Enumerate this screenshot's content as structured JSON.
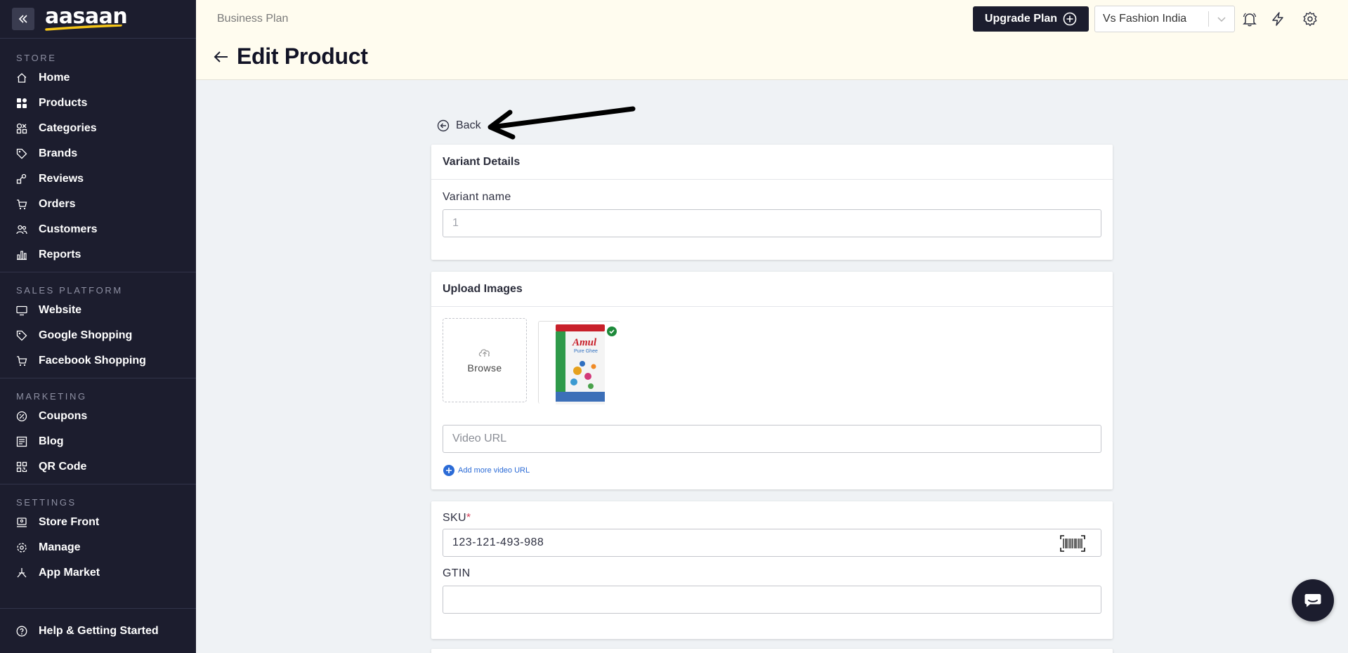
{
  "brand": {
    "logo_text": "aasaan",
    "accent": "#f5c518"
  },
  "sidebar": {
    "sections": [
      {
        "heading": "STORE",
        "items": [
          {
            "label": "Home",
            "icon": "home-icon"
          },
          {
            "label": "Products",
            "icon": "grid-icon"
          },
          {
            "label": "Categories",
            "icon": "categories-icon"
          },
          {
            "label": "Brands",
            "icon": "tag-icon"
          },
          {
            "label": "Reviews",
            "icon": "reviews-icon"
          },
          {
            "label": "Orders",
            "icon": "cart-icon"
          },
          {
            "label": "Customers",
            "icon": "users-icon"
          },
          {
            "label": "Reports",
            "icon": "bar-chart-icon"
          }
        ]
      },
      {
        "heading": "SALES PLATFORM",
        "items": [
          {
            "label": "Website",
            "icon": "monitor-icon"
          },
          {
            "label": "Google Shopping",
            "icon": "tag-icon"
          },
          {
            "label": "Facebook Shopping",
            "icon": "cart-icon"
          }
        ]
      },
      {
        "heading": "MARKETING",
        "items": [
          {
            "label": "Coupons",
            "icon": "coupon-icon"
          },
          {
            "label": "Blog",
            "icon": "blog-icon"
          },
          {
            "label": "QR Code",
            "icon": "qr-icon"
          }
        ]
      },
      {
        "heading": "SETTINGS",
        "items": [
          {
            "label": "Store Front",
            "icon": "storefront-icon"
          },
          {
            "label": "Manage",
            "icon": "gear-icon"
          },
          {
            "label": "App Market",
            "icon": "app-market-icon"
          }
        ]
      }
    ],
    "help_label": "Help & Getting Started"
  },
  "header": {
    "plan_label": "Business Plan",
    "page_title": "Edit Product",
    "upgrade_label": "Upgrade Plan",
    "store_name": "Vs Fashion India"
  },
  "main": {
    "back_label": "Back",
    "variant_card": {
      "title": "Variant Details",
      "name_label": "Variant name",
      "name_placeholder": "1"
    },
    "images_card": {
      "title": "Upload Images",
      "browse_label": "Browse",
      "video_placeholder": "Video URL",
      "add_video_label": "Add more video URL",
      "product_image_text": [
        "Amul",
        "Pure Ghee"
      ]
    },
    "sku_card": {
      "sku_label": "SKU",
      "sku_required": "*",
      "sku_value": "123-121-493-988",
      "gtin_label": "GTIN",
      "gtin_value": ""
    }
  }
}
